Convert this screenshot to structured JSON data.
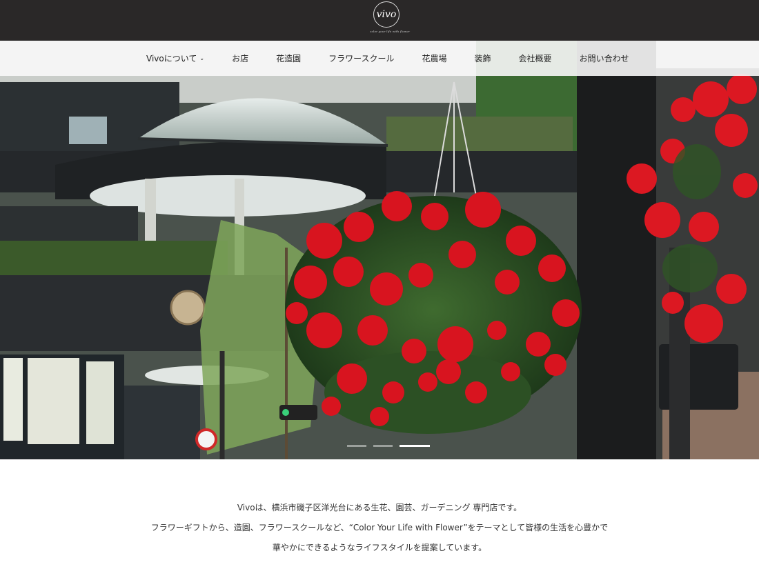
{
  "brand": {
    "logo_text": "vivo",
    "tagline": "color your life with flower"
  },
  "nav": {
    "items": [
      {
        "label": "Vivoについて",
        "has_dropdown": true
      },
      {
        "label": "お店"
      },
      {
        "label": "花造園"
      },
      {
        "label": "フラワースクール"
      },
      {
        "label": "花農場"
      },
      {
        "label": "装飾"
      },
      {
        "label": "会社概要"
      },
      {
        "label": "お問い合わせ"
      }
    ],
    "chevron_icon": "chevron-down-icon"
  },
  "hero": {
    "image": "hanging-flower-basket-photo",
    "slides_total": 3,
    "active_slide": 3
  },
  "intro": {
    "line1": "Vivoは、横浜市磯子区洋光台にある生花、園芸、ガーデニング 専門店です。",
    "line2": "フラワーギフトから、造園、フラワースクールなど、“Color Your Life with Flower”をテーマとして皆様の生活を心豊かで",
    "line3": "華やかにできるようなライフスタイルを提案しています。"
  },
  "colors": {
    "topbar": "#2a2828",
    "nav_background": "#f8f8f8",
    "flower_red": "#d8141f"
  }
}
